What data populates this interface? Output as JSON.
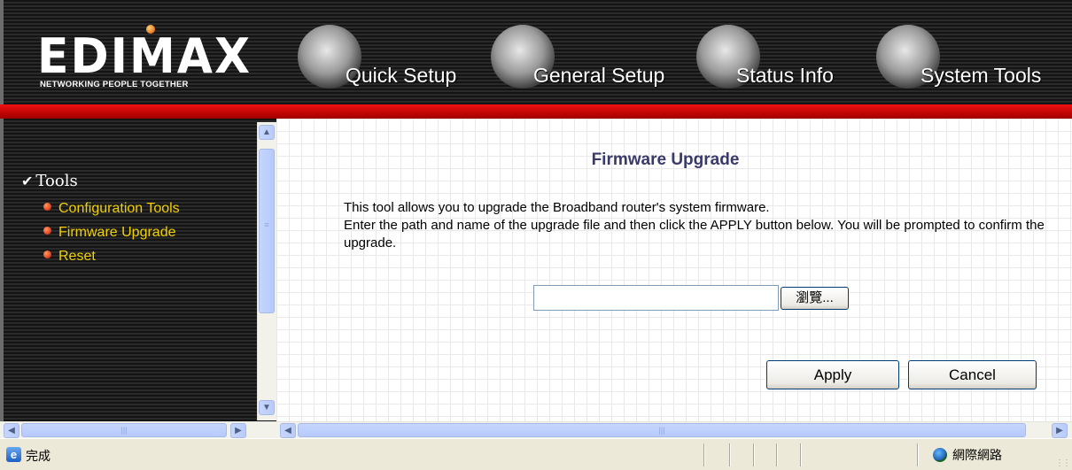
{
  "header": {
    "logo": {
      "brand": "EDIMAX",
      "tagline": "NETWORKING PEOPLE TOGETHER"
    },
    "nav": [
      {
        "label": "Quick Setup",
        "icon": "mouse-icon"
      },
      {
        "label": "General Setup",
        "icon": "keyboard-icon"
      },
      {
        "label": "Status Info",
        "icon": "network-cable-icon"
      },
      {
        "label": "System Tools",
        "icon": "circuit-board-icon"
      }
    ]
  },
  "sidebar": {
    "heading": "Tools",
    "items": [
      {
        "label": "Configuration Tools"
      },
      {
        "label": "Firmware Upgrade"
      },
      {
        "label": "Reset"
      }
    ]
  },
  "main": {
    "title": "Firmware Upgrade",
    "desc_line1": "This tool allows you to upgrade the Broadband router's system firmware.",
    "desc_line2": "Enter the path and name of the upgrade file and then click the APPLY button below. You will be prompted to confirm the upgrade.",
    "file_input_value": "",
    "browse_label": "瀏覽...",
    "apply_label": "Apply",
    "cancel_label": "Cancel"
  },
  "statusbar": {
    "status_text": "完成",
    "zone_text": "網際網路"
  },
  "colors": {
    "menu_text": "#f0d000",
    "header_red": "#e00000",
    "title_text": "#3a3a6a"
  }
}
